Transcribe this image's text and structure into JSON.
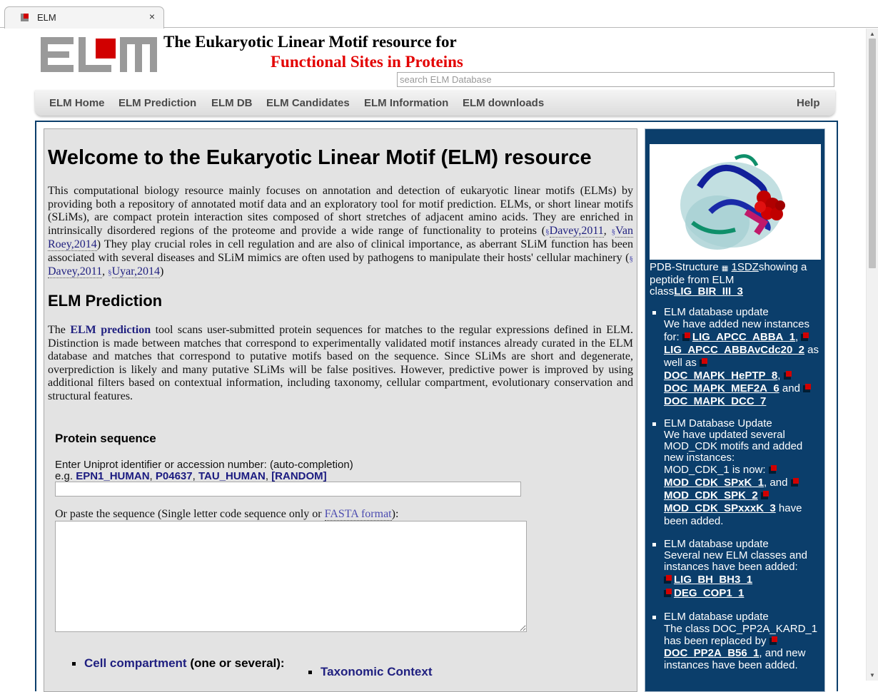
{
  "browser": {
    "tab_title": "ELM",
    "tab_close": "×"
  },
  "header": {
    "title_line1": "The Eukaryotic Linear Motif resource for",
    "title_line2": "Functional Sites in Proteins",
    "search_placeholder": "search ELM Database"
  },
  "nav": {
    "items": [
      "ELM Home",
      "ELM Prediction",
      "ELM DB",
      "ELM Candidates",
      "ELM Information",
      "ELM downloads"
    ],
    "help": "Help"
  },
  "main": {
    "heading": "Welcome to the Eukaryotic Linear Motif (ELM) resource",
    "intro_a": "This computational biology resource mainly focuses on annotation and detection of eukaryotic linear motifs (ELMs) by providing both a repository of annotated motif data and an exploratory tool for motif prediction. ELMs, or short linear motifs (SLiMs), are compact protein interaction sites composed of short stretches of adjacent amino acids. They are enriched in intrinsically disordered regions of the proteome and provide a wide range of functionality to proteins (",
    "cite1": "Davey,2011",
    "cite2": "Van Roey,2014",
    "intro_b": ") They play crucial roles in cell regulation and are also of clinical importance, as aberrant SLiM function has been associated with several diseases and SLiM mimics are often used by pathogens to manipulate their hosts' cellular machinery (",
    "cite3": "Davey,2011",
    "cite4": "Uyar,2014",
    "intro_c": ")",
    "prediction_heading": "ELM Prediction",
    "pred_the": "The ",
    "pred_link": "ELM prediction",
    "pred_text": " tool scans user-submitted protein sequences for matches to the regular expressions defined in ELM. Distinction is made between matches that correspond to experimentally validated motif instances already curated in the ELM database and matches that correspond to putative motifs based on the sequence. Since SLiMs are short and degenerate, overprediction is likely and many putative SLiMs will be false positives. However, predictive power is improved by using additional filters based on contextual information, including taxonomy, cellular compartment, evolutionary conservation and structural features.",
    "protein_heading": "Protein sequence",
    "uniprot_label": "Enter Uniprot identifier or accession number: (auto-completion)",
    "eg_prefix": "e.g. ",
    "examples": [
      "EPN1_HUMAN",
      "P04637",
      "TAU_HUMAN",
      "[RANDOM]"
    ],
    "paste_prefix": "Or paste the sequence (Single letter code sequence only or ",
    "fasta_link": "FASTA format",
    "paste_suffix": "):",
    "cell_compartment_link": "Cell compartment",
    "cell_compartment_suffix": " (one or several):",
    "taxonomic_link": "Taxonomic Context"
  },
  "side": {
    "pdb_prefix": "PDB-Structure ",
    "pdb_id": "1SDZ",
    "pdb_mid": "showing a peptide from ELM class",
    "pdb_class": "LIG_BIR_III_3",
    "news": [
      {
        "title": "ELM database update",
        "text1": "We have added new instances for: ",
        "link1": "LIG_APCC_ABBA_1",
        "link2": "LIG_APCC_ABBAvCdc20_2",
        "text2": " as well as ",
        "link3": "DOC_MAPK_HePTP_8",
        "link4": "DOC_MAPK_MEF2A_6",
        "text3": " and ",
        "link5": "DOC_MAPK_DCC_7"
      },
      {
        "title": "ELM Database Update",
        "text1": "We have updated several MOD_CDK motifs and added new instances:",
        "text2": "MOD_CDK_1 is now: ",
        "link1": "MOD_CDK_SPxK_1",
        "text3": ", and ",
        "link2": "MOD_CDK_SPK_2",
        "link3": "MOD_CDK_SPxxxK_3",
        "text4": " have been added."
      },
      {
        "title": "ELM database update",
        "text1": "Several new ELM classes and instances have been added:",
        "link1": "LIG_BH_BH3_1",
        "link2": "DEG_COP1_1"
      },
      {
        "title": "ELM database update",
        "text1": "The class DOC_PP2A_KARD_1 has been replaced by ",
        "link1": "DOC_PP2A_B56_1",
        "text2": ", and new instances have been added."
      }
    ]
  },
  "colors": {
    "brand_red": "#d10000",
    "sidebar_blue": "#0b3e6b",
    "link_navy": "#202080"
  }
}
